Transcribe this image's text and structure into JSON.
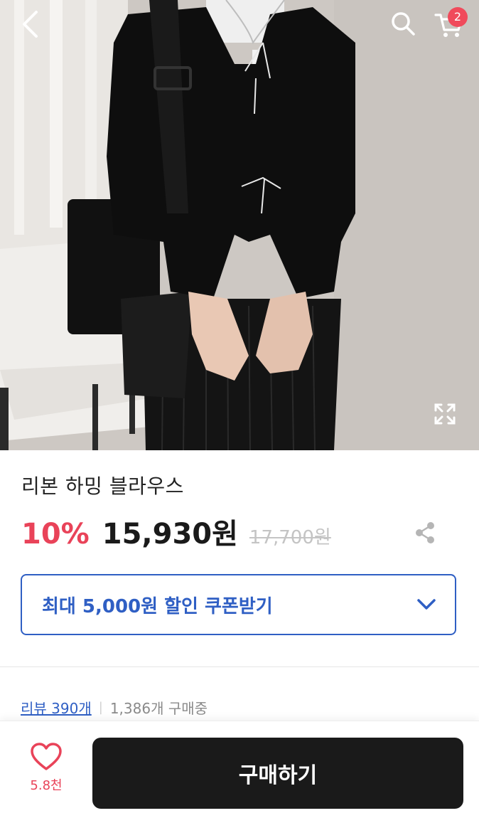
{
  "header": {
    "back_icon": "chevron-left-icon",
    "search_icon": "search-icon",
    "cart_icon": "cart-icon",
    "cart_count": "2"
  },
  "product": {
    "image_alt": "product-photo",
    "zoom_icon": "expand-icon",
    "title": "리본 하밍 블라우스",
    "discount": "10%",
    "price": "15,930원",
    "original_price": "17,700원",
    "share_icon": "share-icon"
  },
  "coupon": {
    "label": "최대 5,000원 할인 쿠폰받기",
    "chevron_icon": "chevron-down-icon"
  },
  "stats": {
    "reviews": "리뷰 390개",
    "separator": "|",
    "buyers": "1,386개 구매중"
  },
  "bottom_bar": {
    "like_icon": "heart-icon",
    "like_count": "5.8천",
    "buy_label": "구매하기"
  },
  "colors": {
    "accent_red": "#e94359",
    "accent_blue": "#2f5fc4",
    "buy_button": "#1a1a1a",
    "badge": "#f04a5b"
  }
}
